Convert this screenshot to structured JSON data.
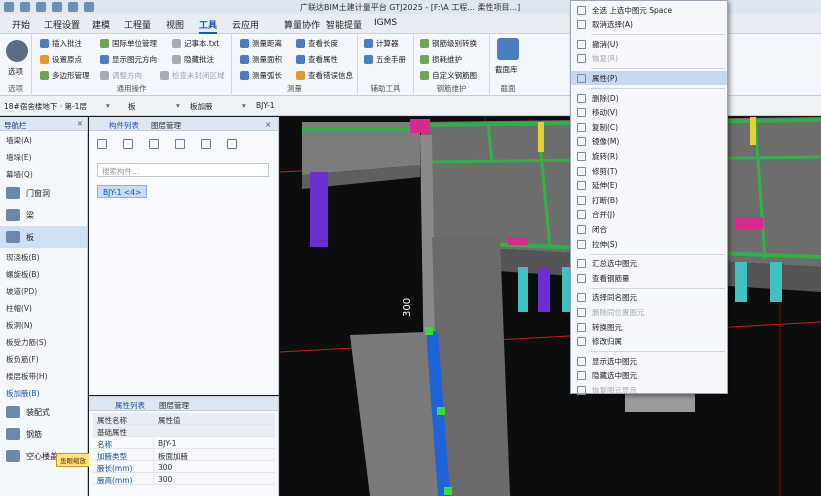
{
  "window": {
    "title": "广联达BIM土建计量平台 GTJ2025 - [F:\\A 工程... 柔性项目...]"
  },
  "menu": {
    "tabs": [
      "开始",
      "工程设置",
      "建模",
      "工程量",
      "视图",
      "工具",
      "云应用",
      "算量协作",
      "智能提量",
      "IGMS"
    ],
    "active": "工具"
  },
  "ribbon": {
    "options": {
      "label": "选项",
      "group": "选项"
    },
    "common": {
      "group": "通用操作",
      "items": [
        "插入批注",
        "国际单位管理",
        "记事本.txt",
        "设置原点",
        "显示图元方向",
        "隐藏批注",
        "多边形管理",
        "调整方向",
        "检查未封闭区域"
      ]
    },
    "measure": {
      "group": "测量",
      "items": [
        "测量距离",
        "查看长度",
        "测量面积",
        "查看属性",
        "测量弧长",
        "查看错误信息"
      ]
    },
    "aux": {
      "group": "辅助工具",
      "items": [
        "计算器",
        "五金手册"
      ]
    },
    "rebar": {
      "group": "钢筋维护",
      "items": [
        "钢筋级别转换",
        "损耗维护",
        "自定义钢筋图"
      ]
    },
    "section": {
      "group": "截面",
      "label": "截面库"
    }
  },
  "selector": {
    "floor": "18#宿舍楼地下 · 第-1层",
    "type": "板",
    "sub": "板加腋",
    "name": "BJY-1"
  },
  "navigator": {
    "title": "导航栏",
    "top_items": [
      "墙梁(A)",
      "墙垛(E)",
      "幕墙(Q)"
    ],
    "categories": [
      {
        "label": "门窗洞",
        "selected": false
      },
      {
        "label": "梁",
        "selected": false
      },
      {
        "label": "板",
        "selected": true
      }
    ],
    "board_items": [
      "现浇板(B)",
      "螺旋板(B)",
      "坡道(PD)",
      "柱帽(V)",
      "板洞(N)",
      "板受力筋(S)",
      "板负筋(F)",
      "楼层板带(H)",
      "板加腋(B)"
    ],
    "bottom_categories": [
      "装配式",
      "钢筋",
      "空心楼盖"
    ]
  },
  "components": {
    "tab_list": "构件列表",
    "tab_layer": "图层管理",
    "search_placeholder": "搜索构件...",
    "chip": "BJY-1 <4>"
  },
  "properties": {
    "tab_list": "属性列表",
    "tab_layer": "图层管理",
    "col_name": "属性名称",
    "col_value": "属性值",
    "group": "基础属性",
    "rows": [
      {
        "name": "名称",
        "value": "BJY-1"
      },
      {
        "name": "加腋类型",
        "value": "板面加腋"
      },
      {
        "name": "腋长(mm)",
        "value": "300"
      },
      {
        "name": "腋高(mm)",
        "value": "300"
      }
    ]
  },
  "tooltip": "鱼眼缩放",
  "viewport": {
    "dim_label": "300"
  },
  "context_menu": {
    "items": [
      {
        "label": "全选 上选中图元  Space",
        "dim": false,
        "hl": false
      },
      {
        "label": "取消选择(A)",
        "dim": false,
        "hl": false
      },
      {
        "label": "撤消(U)",
        "dim": false,
        "hl": false,
        "sep_before": true
      },
      {
        "label": "恢复(R)",
        "dim": true,
        "hl": false
      },
      {
        "label": "属性(P)",
        "dim": false,
        "hl": true,
        "sep_before": true
      },
      {
        "label": "删除(D)",
        "dim": false,
        "hl": false,
        "sep_before": true
      },
      {
        "label": "移动(V)",
        "dim": false,
        "hl": false
      },
      {
        "label": "复制(C)",
        "dim": false,
        "hl": false
      },
      {
        "label": "镜像(M)",
        "dim": false,
        "hl": false
      },
      {
        "label": "旋转(R)",
        "dim": false,
        "hl": false
      },
      {
        "label": "修剪(T)",
        "dim": false,
        "hl": false
      },
      {
        "label": "延伸(E)",
        "dim": false,
        "hl": false
      },
      {
        "label": "打断(B)",
        "dim": false,
        "hl": false
      },
      {
        "label": "合并(J)",
        "dim": false,
        "hl": false
      },
      {
        "label": "闭合",
        "dim": false,
        "hl": false
      },
      {
        "label": "拉伸(S)",
        "dim": false,
        "hl": false
      },
      {
        "label": "汇总选中图元",
        "dim": false,
        "hl": false,
        "sep_before": true
      },
      {
        "label": "查看钢筋量",
        "dim": false,
        "hl": false
      },
      {
        "label": "选择同名图元",
        "dim": false,
        "hl": false,
        "sep_before": true
      },
      {
        "label": "删除同位置图元",
        "dim": true,
        "hl": false
      },
      {
        "label": "转换图元",
        "dim": false,
        "hl": false
      },
      {
        "label": "修改归属",
        "dim": false,
        "hl": false
      },
      {
        "label": "显示选中图元",
        "dim": false,
        "hl": false,
        "sep_before": true
      },
      {
        "label": "隐藏选中图元",
        "dim": false,
        "hl": false
      },
      {
        "label": "恢复图元显示",
        "dim": true,
        "hl": false
      }
    ]
  }
}
